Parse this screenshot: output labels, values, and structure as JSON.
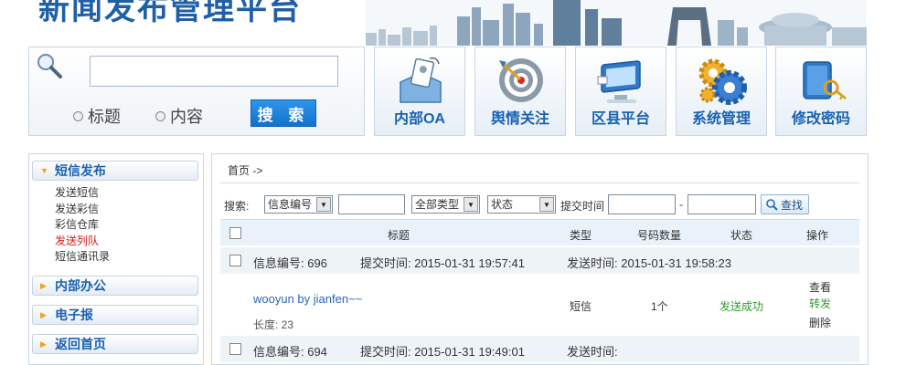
{
  "header": {
    "title": "新闻发布管理平台"
  },
  "search": {
    "value": "",
    "radio_title": "标题",
    "radio_content": "内容",
    "button_label": "搜 索"
  },
  "tiles": [
    {
      "label": "内部OA",
      "icon": "id-card-icon"
    },
    {
      "label": "舆情关注",
      "icon": "target-icon"
    },
    {
      "label": "区县平台",
      "icon": "monitor-icon"
    },
    {
      "label": "系统管理",
      "icon": "gears-icon"
    },
    {
      "label": "修改密码",
      "icon": "key-icon"
    }
  ],
  "sidebar": {
    "groups": [
      {
        "label": "短信发布",
        "expanded": true
      },
      {
        "label": "内部办公",
        "expanded": false
      },
      {
        "label": "电子报",
        "expanded": false
      },
      {
        "label": "返回首页",
        "expanded": false
      }
    ],
    "sub_items": [
      {
        "label": "发送短信",
        "active": false
      },
      {
        "label": "发送彩信",
        "active": false
      },
      {
        "label": "彩信仓库",
        "active": false
      },
      {
        "label": "发送列队",
        "active": true
      },
      {
        "label": "短信通讯录",
        "active": false
      }
    ]
  },
  "main": {
    "breadcrumb": "首页 ->",
    "filter": {
      "search_label": "搜索:",
      "field_select": "信息编号",
      "field_value": "",
      "type_select": "全部类型",
      "status_select": "状态",
      "time_label": "提交时间",
      "time_sep": "-",
      "time_from": "",
      "time_to": "",
      "find_label": "查找"
    },
    "columns": {
      "title": "标题",
      "type": "类型",
      "count": "号码数量",
      "status": "状态",
      "ops": "操作"
    },
    "records": [
      {
        "id_text": "信息编号: 696",
        "submit_text": "提交时间: 2015-01-31 19:57:41",
        "send_text": "发送时间: 2015-01-31 19:58:23",
        "title": "wooyun by jianfen~~",
        "length": "长度: 23",
        "type": "短信",
        "count": "1个",
        "status": "发送成功",
        "op_view": "查看",
        "op_forward": "转发",
        "op_delete": "删除"
      },
      {
        "id_text": "信息编号: 694",
        "submit_text": "提交时间: 2015-01-31 19:49:01",
        "send_text": "发送时间:"
      }
    ]
  },
  "colors": {
    "accent_blue": "#1a62b0",
    "success_green": "#2f9a2f",
    "active_red": "#d31a1a",
    "button_blue": "#1171cf"
  }
}
